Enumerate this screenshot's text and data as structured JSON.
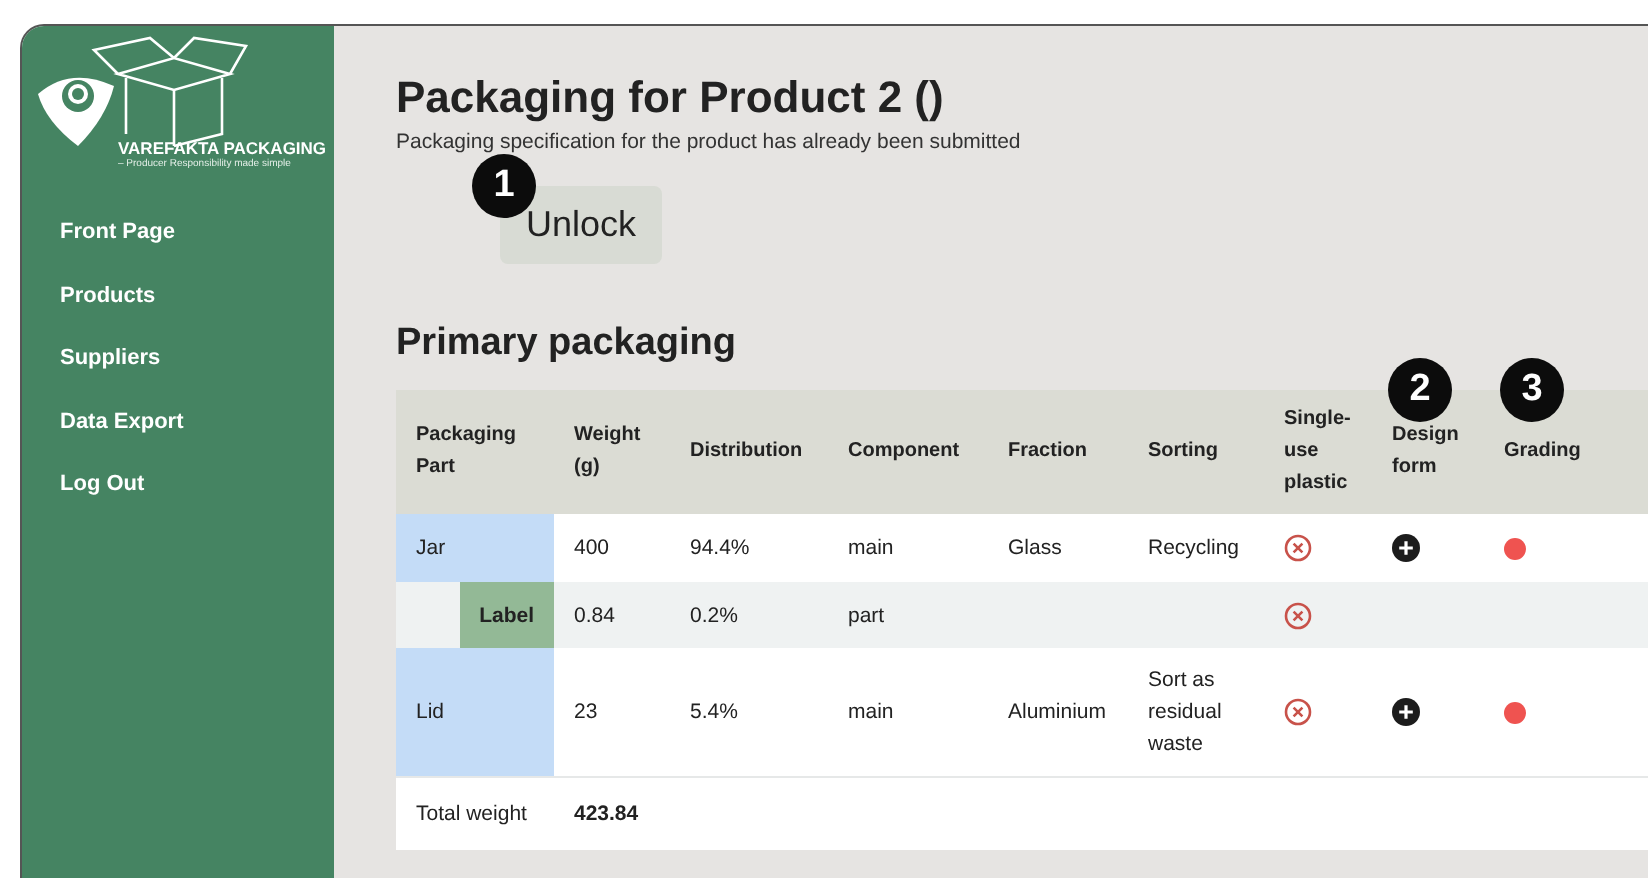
{
  "sidebar": {
    "logo": {
      "name": "VAREFAKTA PACKAGING",
      "tagline": "– Producer Responsibility made simple"
    },
    "items": [
      {
        "label": "Front Page"
      },
      {
        "label": "Products"
      },
      {
        "label": "Suppliers"
      },
      {
        "label": "Data Export"
      },
      {
        "label": "Log Out"
      }
    ]
  },
  "page": {
    "title": "Packaging for Product 2 ()",
    "subtitle": "Packaging specification for the product has already been submitted",
    "unlock_button": "Unlock"
  },
  "section": {
    "title": "Primary packaging"
  },
  "table": {
    "columns": [
      "Packaging Part",
      "Weight (g)",
      "Distribution",
      "Component",
      "Fraction",
      "Sorting",
      "Single-use plastic",
      "Design form",
      "Grading"
    ],
    "rows": [
      {
        "part": "Jar",
        "kind": "main",
        "weight": "400",
        "distribution": "94.4%",
        "component": "main",
        "fraction": "Glass",
        "sorting": "Recycling",
        "single_use_plastic": false,
        "design_form_button": true,
        "grading": {
          "color": "#ef5350"
        }
      },
      {
        "part": "Label",
        "kind": "part",
        "weight": "0.84",
        "distribution": "0.2%",
        "component": "part",
        "single_use_plastic": false,
        "design_form_button": false
      },
      {
        "part": "Lid",
        "kind": "main",
        "weight": "23",
        "distribution": "5.4%",
        "component": "main",
        "fraction": "Aluminium",
        "sorting": "Sort as residual waste",
        "single_use_plastic": false,
        "design_form_button": true,
        "grading": {
          "color": "#ef5350"
        }
      }
    ],
    "total": {
      "label": "Total weight",
      "value": "423.84"
    }
  },
  "callouts": [
    {
      "number": "1"
    },
    {
      "number": "2"
    },
    {
      "number": "3"
    }
  ]
}
